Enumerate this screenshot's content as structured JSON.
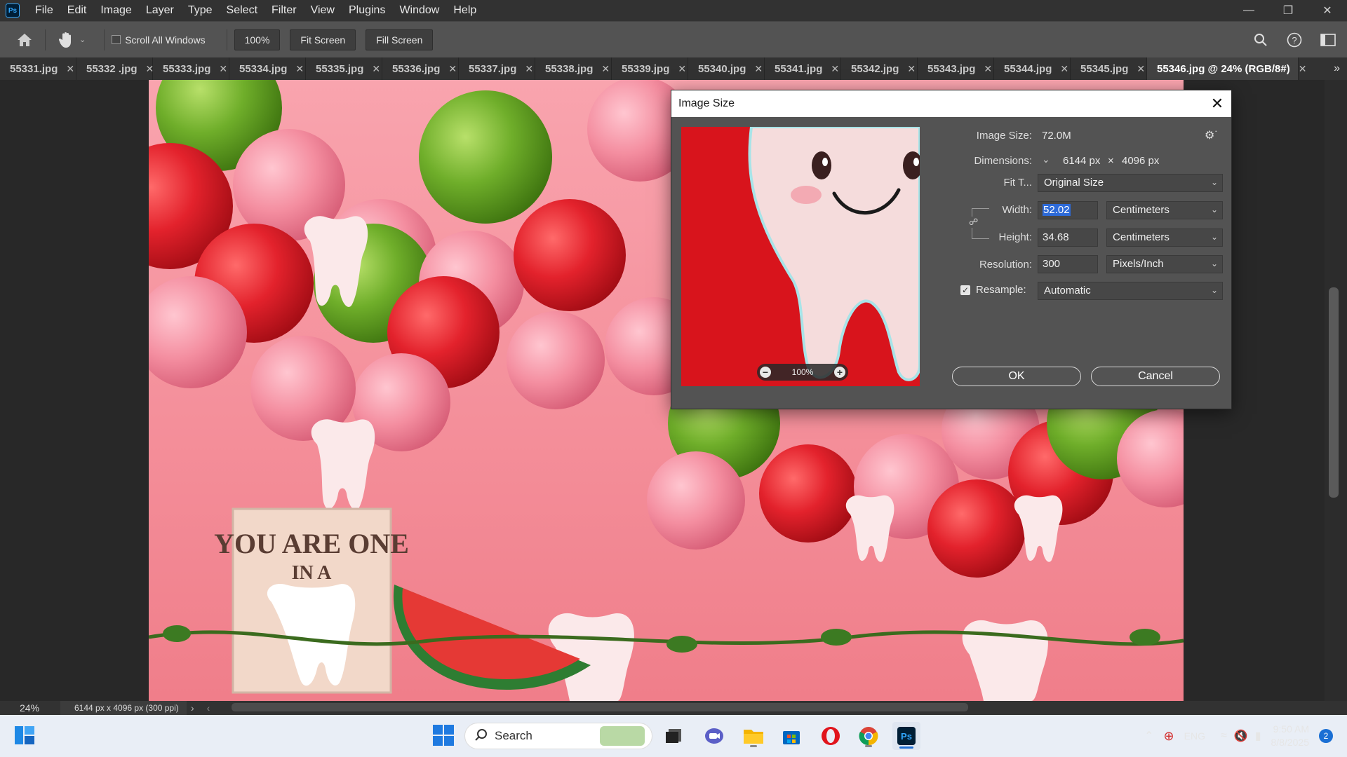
{
  "menubar": {
    "logo": "Ps",
    "items": [
      "File",
      "Edit",
      "Image",
      "Layer",
      "Type",
      "Select",
      "Filter",
      "View",
      "Plugins",
      "Window",
      "Help"
    ]
  },
  "options": {
    "scroll_all_windows": "Scroll All Windows",
    "zoom_btn": "100%",
    "fit_screen_btn": "Fit Screen",
    "fill_screen_btn": "Fill Screen"
  },
  "tabs": [
    {
      "label": "55331.jpg"
    },
    {
      "label": "55332 .jpg"
    },
    {
      "label": "55333.jpg"
    },
    {
      "label": "55334.jpg"
    },
    {
      "label": "55335.jpg"
    },
    {
      "label": "55336.jpg"
    },
    {
      "label": "55337.jpg"
    },
    {
      "label": "55338.jpg"
    },
    {
      "label": "55339.jpg"
    },
    {
      "label": "55340.jpg"
    },
    {
      "label": "55341.jpg"
    },
    {
      "label": "55342.jpg"
    },
    {
      "label": "55343.jpg"
    },
    {
      "label": "55344.jpg"
    },
    {
      "label": "55345.jpg"
    },
    {
      "label": "55346.jpg @ 24% (RGB/8#)",
      "active": true
    }
  ],
  "document": {
    "sign_line1": "YOU ARE ONE",
    "sign_line2": "IN A"
  },
  "dialog": {
    "title": "Image Size",
    "image_size_label": "Image Size:",
    "image_size_value": "72.0M",
    "dimensions_label": "Dimensions:",
    "dim_width": "6144 px",
    "dim_x": "×",
    "dim_height": "4096 px",
    "fit_to_label": "Fit T...",
    "fit_to_value": "Original Size",
    "width_label": "Width:",
    "width_value": "52.02",
    "width_unit": "Centimeters",
    "height_label": "Height:",
    "height_value": "34.68",
    "height_unit": "Centimeters",
    "resolution_label": "Resolution:",
    "resolution_value": "300",
    "resolution_unit": "Pixels/Inch",
    "resample_label": "Resample:",
    "resample_value": "Automatic",
    "preview_zoom": "100%",
    "ok": "OK",
    "cancel": "Cancel"
  },
  "status": {
    "zoom": "24%",
    "doc_info": "6144 px x 4096 px (300 ppi)"
  },
  "taskbar": {
    "search_placeholder": "Search",
    "language": "ENG",
    "time": "9:50 AM",
    "date": "8/8/2025",
    "notifications": "2"
  },
  "colors": {
    "accent": "#2d6ad8",
    "pink_bg": "#f28891",
    "balloon_red": "#e3222c",
    "balloon_green": "#6fae2a",
    "balloon_pink": "#f48ea0"
  }
}
